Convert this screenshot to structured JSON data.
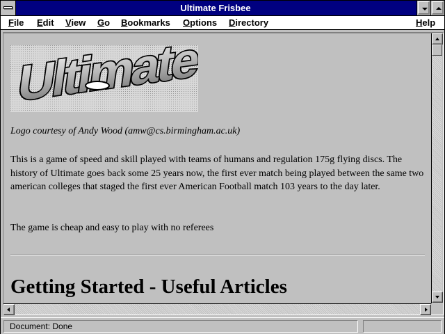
{
  "window": {
    "title": "Ultimate Frisbee"
  },
  "menu": {
    "items": [
      {
        "label": "File",
        "accel": "F",
        "rest": "ile"
      },
      {
        "label": "Edit",
        "accel": "E",
        "rest": "dit"
      },
      {
        "label": "View",
        "accel": "V",
        "rest": "iew"
      },
      {
        "label": "Go",
        "accel": "G",
        "rest": "o"
      },
      {
        "label": "Bookmarks",
        "accel": "B",
        "rest": "ookmarks"
      },
      {
        "label": "Options",
        "accel": "O",
        "rest": "ptions"
      },
      {
        "label": "Directory",
        "accel": "D",
        "rest": "irectory"
      },
      {
        "label": "Help",
        "accel": "H",
        "rest": "elp"
      }
    ]
  },
  "page": {
    "logo_text": "Ultimate",
    "caption": "Logo courtesy of Andy Wood (amw@cs.birmingham.ac.uk)",
    "paragraphs": [
      "This is a game of speed and skill played with teams of humans and regulation 175g flying discs. The history of Ultimate goes back some 25 years now, the first ever match being played between the same two american colleges that staged the first ever American Football match 103 years to the day later.",
      "The game is cheap and easy to play with no referees"
    ],
    "heading": "Getting Started - Useful Articles"
  },
  "status": {
    "text": "Document: Done"
  },
  "colors": {
    "titlebar": "#000080",
    "chrome": "#c0c0c0",
    "content_bg": "#c0c0c0"
  },
  "icons": [
    "system-menu-icon",
    "minimize-icon",
    "maximize-icon",
    "scroll-up-icon",
    "scroll-down-icon",
    "scroll-left-icon",
    "scroll-right-icon"
  ]
}
